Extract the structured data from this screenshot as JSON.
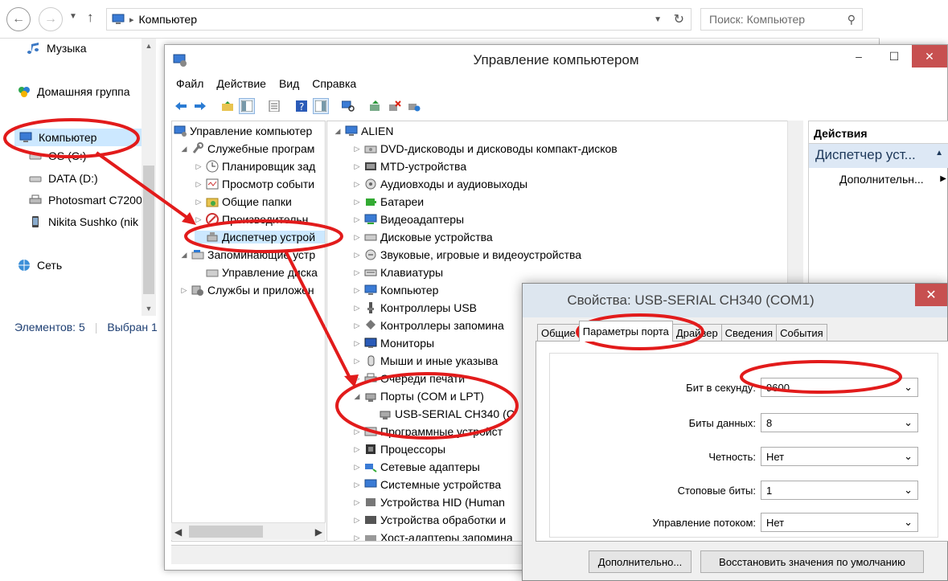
{
  "explorer": {
    "address": "Компьютер",
    "search_placeholder": "Поиск: Компьютер",
    "nav": [
      {
        "label": "Музыка",
        "icon": "music-icon"
      },
      {
        "label": "Домашняя группа",
        "icon": "homegroup-icon"
      },
      {
        "label": "Компьютер",
        "icon": "computer-icon"
      },
      {
        "label": "OS (C:)",
        "icon": "drive-icon"
      },
      {
        "label": "DATA (D:)",
        "icon": "drive-icon"
      },
      {
        "label": "Photosmart C7200",
        "icon": "device-icon"
      },
      {
        "label": "Nikita Sushko (nik",
        "icon": "phone-icon"
      },
      {
        "label": "Сеть",
        "icon": "network-icon"
      }
    ],
    "status_items": "Элементов: 5",
    "status_selected": "Выбран 1"
  },
  "mgmt": {
    "title": "Управление компьютером",
    "menu": [
      "Файл",
      "Действие",
      "Вид",
      "Справка"
    ],
    "tree": [
      "Управление компьютер",
      "Служебные програм",
      "Планировщик зад",
      "Просмотр событи",
      "Общие папки",
      "Производительн",
      "Диспетчер устрой",
      "Запоминающие устр",
      "Управление диска",
      "Службы и приложен"
    ],
    "root": "ALIEN",
    "devices": [
      "DVD-дисководы и дисководы компакт-дисков",
      "MTD-устройства",
      "Аудиовходы и аудиовыходы",
      "Батареи",
      "Видеоадаптеры",
      "Дисковые устройства",
      "Звуковые, игровые и видеоустройства",
      "Клавиатуры",
      "Компьютер",
      "Контроллеры USB",
      "Контроллеры запомина",
      "Мониторы",
      "Мыши и иные указыва",
      "Очереди печати",
      "Порты (COM и LPT)",
      "USB-SERIAL CH340 (C",
      "Программные устройст",
      "Процессоры",
      "Сетевые адаптеры",
      "Системные устройства",
      "Устройства HID (Human",
      "Устройства обработки и",
      "Хост-адаптеры запомина"
    ],
    "actions_header": "Действия",
    "actions_sub": "Диспетчер уст...",
    "actions_more": "Дополнительн..."
  },
  "dialog": {
    "title": "Свойства: USB-SERIAL CH340 (COM1)",
    "tabs": [
      "Общие",
      "Параметры порта",
      "Драйвер",
      "Сведения",
      "События"
    ],
    "fields": [
      {
        "label": "Бит в секунду:",
        "value": "9600"
      },
      {
        "label": "Биты данных:",
        "value": "8"
      },
      {
        "label": "Четность:",
        "value": "Нет"
      },
      {
        "label": "Стоповые биты:",
        "value": "1"
      },
      {
        "label": "Управление потоком:",
        "value": "Нет"
      }
    ],
    "btn_advanced": "Дополнительно...",
    "btn_restore": "Восстановить значения по умолчанию"
  },
  "colors": {
    "annotation": "#e21b1b",
    "selection": "#cce8ff",
    "accent": "#1e395b"
  }
}
